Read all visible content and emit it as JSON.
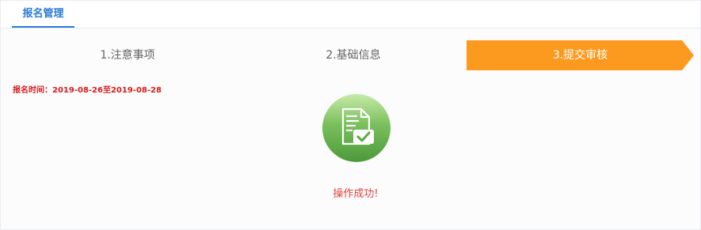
{
  "tabs": [
    {
      "label": "报名管理",
      "active": true
    }
  ],
  "steps": [
    {
      "label": "1.注意事项",
      "active": false
    },
    {
      "label": "2.基础信息",
      "active": false
    },
    {
      "label": "3.提交审核",
      "active": true
    }
  ],
  "registration_time": "报名时间：2019-08-26至2019-08-28",
  "success_icon": "document-check-icon",
  "success_message": "操作成功!",
  "colors": {
    "accent_blue": "#2a7ad5",
    "step_active": "#fc9a20",
    "alert_red": "#d71c1c",
    "icon_green": "#5fa845"
  }
}
